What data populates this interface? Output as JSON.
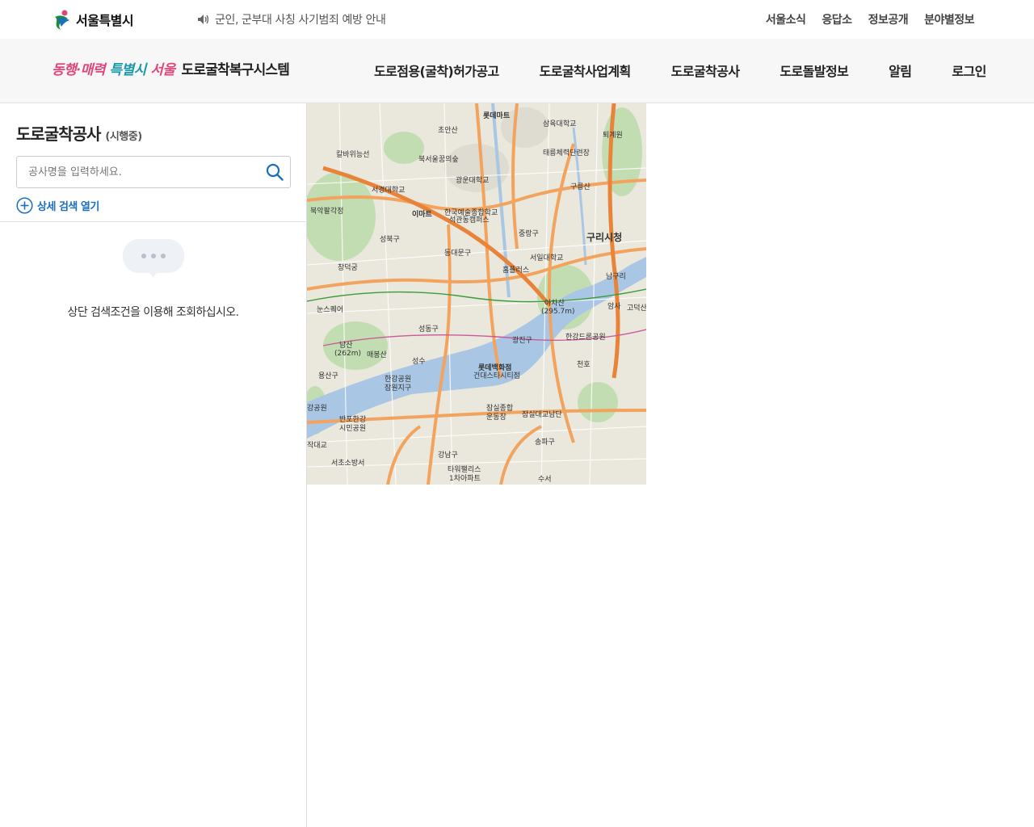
{
  "topbar": {
    "seoul_logo_text": "서울특별시",
    "notice_text": "군인, 군부대 사칭 사기범죄 예방 안내",
    "links": [
      "서울소식",
      "응답소",
      "정보공개",
      "분야별정보"
    ]
  },
  "header": {
    "slogan_1": "동행·매력",
    "slogan_2": "특별시",
    "slogan_3": "서울",
    "system_name": "도로굴착복구시스템",
    "nav": [
      "도로점용(굴착)허가공고",
      "도로굴착사업계획",
      "도로굴착공사",
      "도로돌발정보",
      "알림",
      "로그인"
    ]
  },
  "panel": {
    "title": "도로굴착공사",
    "subtitle": "(시행중)",
    "search_placeholder": "공사명을 입력하세요.",
    "search_value": "",
    "detail_toggle": "상세 검색 열기",
    "empty_message": "상단 검색조건을 이용해 조회하십시오."
  },
  "map": {
    "labels": [
      "롯데마트",
      "삼육대학교",
      "초안산",
      "퇴계원",
      "칼바위능선",
      "북서울꿈의숲",
      "태릉체력단련장",
      "광운대학교",
      "서경대학교",
      "구릉산",
      "북악팔각정",
      "이마트",
      "한국예술종합학교",
      "석관동캠퍼스",
      "구리시청",
      "성북구",
      "중랑구",
      "동대문구",
      "서일대학교",
      "홈플러스",
      "창덕궁",
      "남구리",
      "눈스퀘어",
      "아차산",
      "(295.7m)",
      "암사",
      "고덕산",
      "성동구",
      "광진구",
      "한강드론공원",
      "남산",
      "(262m)",
      "매봉산",
      "성수",
      "천호",
      "용산구",
      "롯데백화점",
      "건대스타시티점",
      "한강공원",
      "잠원지구",
      "잠실종합",
      "운동장",
      "잠실대교남단",
      "반포한강",
      "시민공원",
      "송파구",
      "강남구",
      "서초소방서",
      "타워팰리스",
      "1차아파트",
      "수서",
      "강공원",
      "작대교"
    ]
  },
  "colors": {
    "accent": "#1a6fbf",
    "header_bg": "#f7f7f7",
    "slogan_pink": "#e0457b",
    "slogan_teal": "#1a9aa8"
  },
  "icons": {
    "search": "search-icon",
    "speaker": "speaker-icon",
    "plus": "plus-circle-icon",
    "empty": "speech-bubble-icon"
  }
}
